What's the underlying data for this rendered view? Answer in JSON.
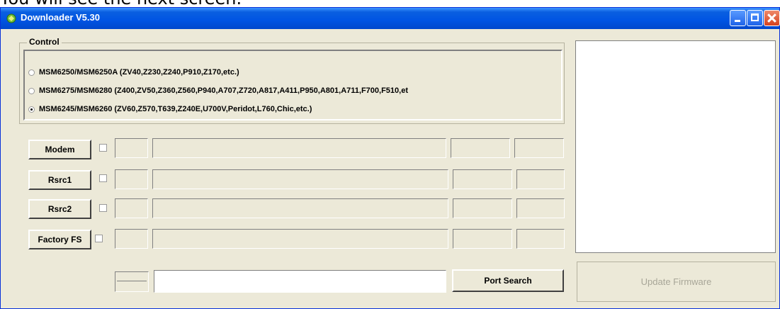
{
  "caption": "You will see the next screen.",
  "window": {
    "title": "Downloader V5.30"
  },
  "control": {
    "legend": "Control",
    "options": [
      {
        "label": "MSM6250/MSM6250A (ZV40,Z230,Z240,P910,Z170,etc.)",
        "checked": false
      },
      {
        "label": "MSM6275/MSM6280 (Z400,ZV50,Z360,Z560,P940,A707,Z720,A817,A411,P950,A801,A711,F700,F510,et",
        "checked": false
      },
      {
        "label": "MSM6245/MSM6260 (ZV60,Z570,T639,Z240E,U700V,Peridot,L760,Chic,etc.)",
        "checked": true
      }
    ]
  },
  "rows": [
    {
      "button": "Modem",
      "checked": false
    },
    {
      "button": "Rsrc1",
      "checked": false
    },
    {
      "button": "Rsrc2",
      "checked": false
    },
    {
      "button": "Factory FS",
      "checked": false
    }
  ],
  "port": {
    "value": "",
    "search_label": "Port Search"
  },
  "update": {
    "label": "Update Firmware",
    "enabled": false
  }
}
